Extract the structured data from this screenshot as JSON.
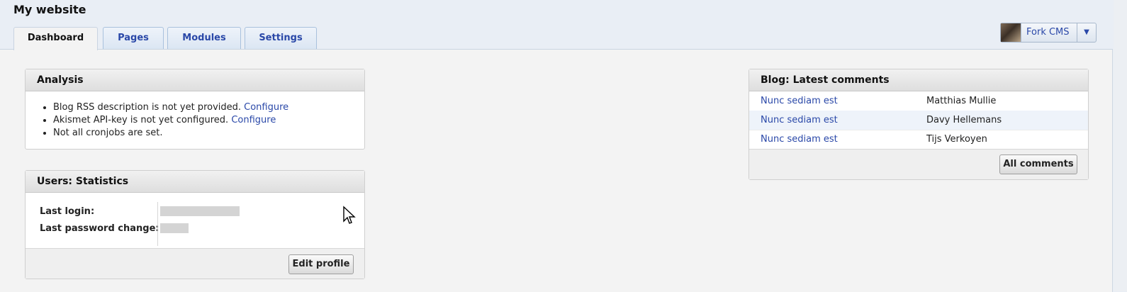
{
  "header": {
    "site_title": "My website"
  },
  "tabs": [
    {
      "label": "Dashboard",
      "active": true
    },
    {
      "label": "Pages",
      "active": false
    },
    {
      "label": "Modules",
      "active": false
    },
    {
      "label": "Settings",
      "active": false
    }
  ],
  "user_menu": {
    "name": "Fork CMS",
    "dropdown_glyph": "▼"
  },
  "analysis": {
    "title": "Analysis",
    "items": [
      {
        "text": "Blog RSS description is not yet provided.",
        "link": "Configure"
      },
      {
        "text": "Akismet API-key is not yet configured.",
        "link": "Configure"
      },
      {
        "text": "Not all cronjobs are set.",
        "link": ""
      }
    ]
  },
  "user_stats": {
    "title": "Users: Statistics",
    "last_login_label": "Last login:",
    "last_password_change_label": "Last password change:",
    "edit_button": "Edit profile"
  },
  "blog_comments": {
    "title": "Blog: Latest comments",
    "rows": [
      {
        "title": "Nunc sediam est",
        "author": "Matthias Mullie"
      },
      {
        "title": "Nunc sediam est",
        "author": "Davy Hellemans"
      },
      {
        "title": "Nunc sediam est",
        "author": "Tijs Verkoyen"
      }
    ],
    "all_button": "All comments"
  },
  "colors": {
    "link": "#2a48a8",
    "page_background": "#e9eef5",
    "content_background": "#f3f3f3"
  }
}
